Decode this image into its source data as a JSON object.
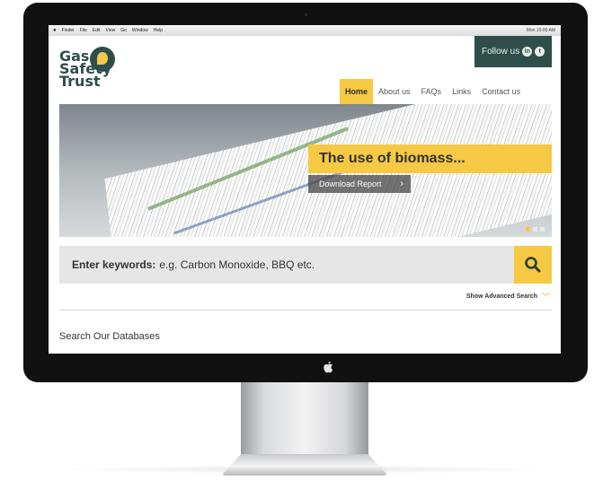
{
  "menubar": {
    "items": [
      "Finder",
      "File",
      "Edit",
      "View",
      "Go",
      "Window",
      "Help"
    ],
    "status": "Mon 10:00 AM"
  },
  "logo": {
    "line1": "Gas",
    "line2": "Safety",
    "line3": "Trust"
  },
  "social": {
    "follow_label": "Follow us",
    "linkedin_glyph": "in",
    "twitter_glyph": "t"
  },
  "nav": {
    "items": [
      "Home",
      "About us",
      "FAQs",
      "Links",
      "Contact us"
    ],
    "active": "Home"
  },
  "hero": {
    "title": "The use of biomass...",
    "button_label": "Download Report",
    "slides": 3,
    "active_slide": 1
  },
  "search": {
    "label": "Enter keywords:",
    "placeholder": "e.g. Carbon Monoxide, BBQ etc."
  },
  "advanced_search": {
    "label": "Show Advanced Search"
  },
  "section": {
    "title": "Search Our Databases"
  },
  "colors": {
    "accent": "#f5c944",
    "brand": "#2f4e4a",
    "search_bg": "#e6e6e6"
  }
}
